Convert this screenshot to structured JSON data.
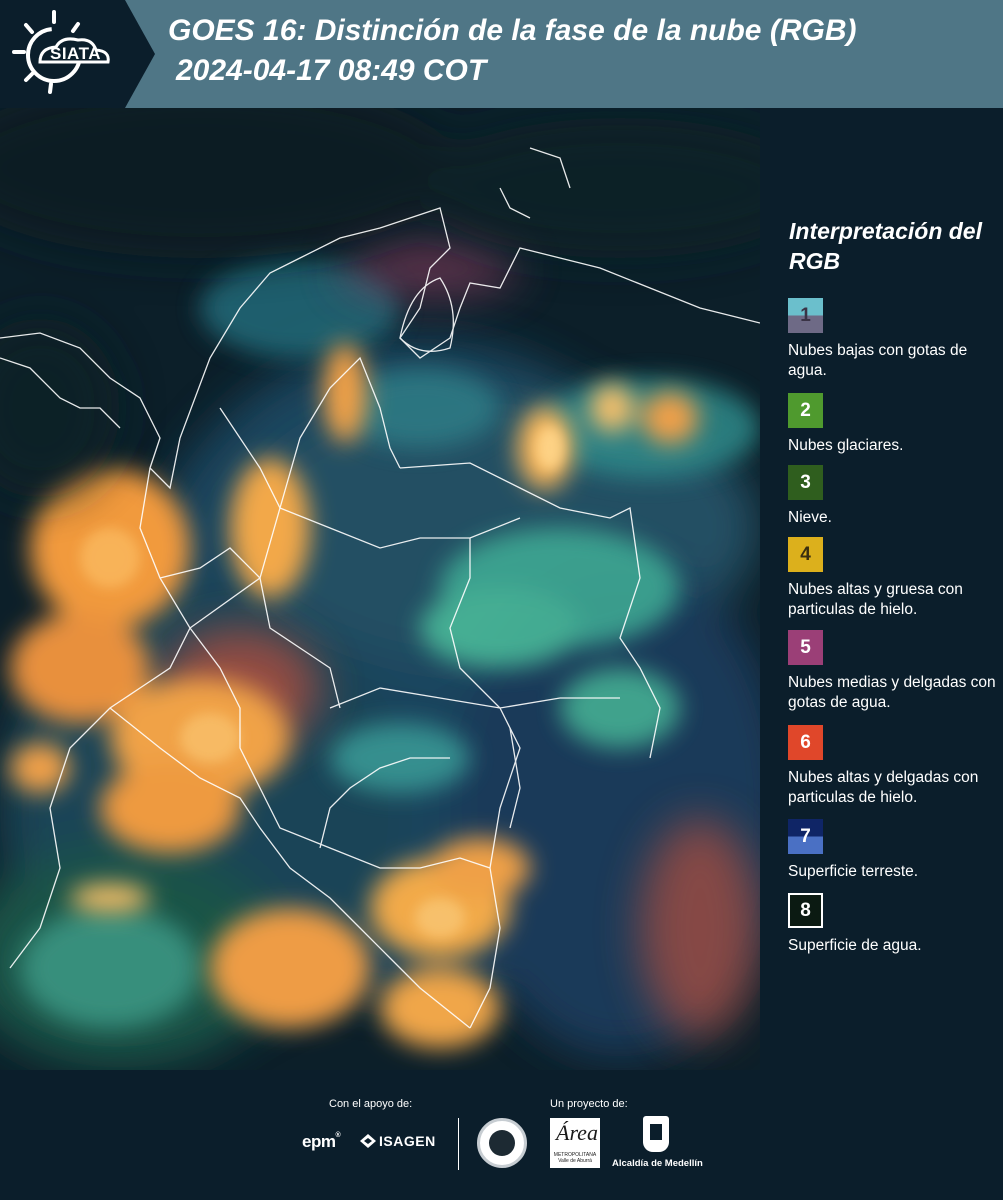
{
  "header": {
    "logo_text": "SIATA",
    "title": "GOES 16: Distinción de la fase de la nube (RGB)",
    "timestamp": "2024-04-17 08:49 COT",
    "background_color": "#4f7686"
  },
  "map": {
    "description_icon": "satellite-rgb-map",
    "colors": {
      "ocean": "#0d2330",
      "land": "#1e3f55",
      "ice_cloud": "#f0a23a",
      "glacial_cloud": "#4fbfa0",
      "borders": "#ffffff"
    }
  },
  "legend": {
    "title": "Interpretación del RGB",
    "items": [
      {
        "number": "1",
        "label": "Nubes bajas con gotas de agua.",
        "color": "#6bbfcc"
      },
      {
        "number": "2",
        "label": "Nubes glaciares.",
        "color": "#4f9a2e"
      },
      {
        "number": "3",
        "label": "Nieve.",
        "color": "#2f5e1e"
      },
      {
        "number": "4",
        "label": "Nubes altas y gruesa con particulas de hielo.",
        "color": "#dcb01c"
      },
      {
        "number": "5",
        "label": "Nubes medias y delgadas con gotas de agua.",
        "color": "#9b3f77"
      },
      {
        "number": "6",
        "label": "Nubes altas y delgadas con particulas de hielo.",
        "color": "#e0472a"
      },
      {
        "number": "7",
        "label": "Superficie terreste.",
        "color": "#0f2566"
      },
      {
        "number": "8",
        "label": "Superficie de agua.",
        "color": "#0b1a12"
      }
    ]
  },
  "footer": {
    "support_label": "Con el apoyo de:",
    "project_label": "Un proyecto de:",
    "sponsors": [
      "epm",
      "ISAGEN"
    ],
    "seal_icon": "university-seal-icon",
    "area_logo_mark": "Área",
    "area_logo_sub": "METROPOLITANA Valle de Aburrá",
    "alcaldia_name": "Alcaldía de Medellín"
  }
}
